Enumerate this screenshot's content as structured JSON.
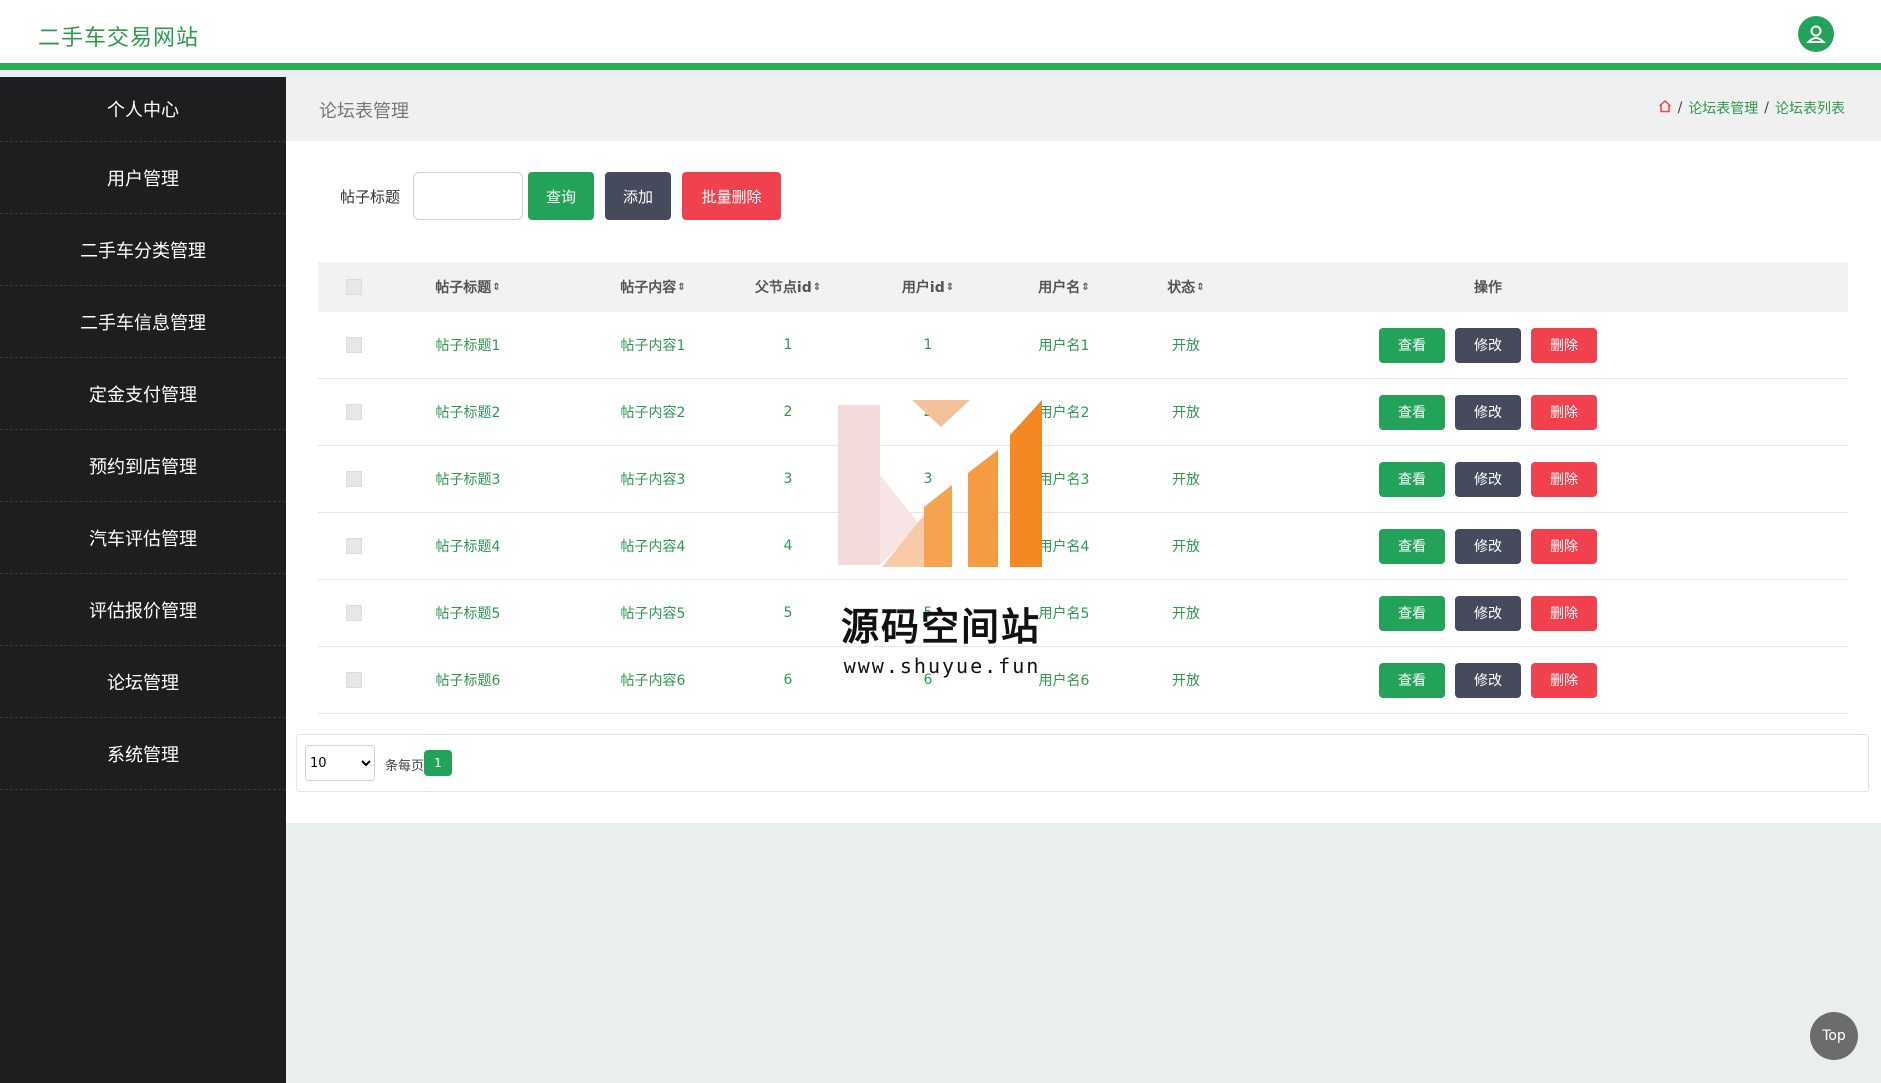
{
  "header": {
    "site_title": "二手车交易网站",
    "user_icon": "user-icon"
  },
  "sidebar": {
    "items": [
      {
        "label": "个人中心"
      },
      {
        "label": "用户管理"
      },
      {
        "label": "二手车分类管理"
      },
      {
        "label": "二手车信息管理"
      },
      {
        "label": "定金支付管理"
      },
      {
        "label": "预约到店管理"
      },
      {
        "label": "汽车评估管理"
      },
      {
        "label": "评估报价管理"
      },
      {
        "label": "论坛管理"
      },
      {
        "label": "系统管理"
      }
    ]
  },
  "page": {
    "title": "论坛表管理",
    "breadcrumb": [
      "论坛表管理",
      "论坛表列表"
    ]
  },
  "search": {
    "label": "帖子标题",
    "value": "",
    "query_label": "查询",
    "add_label": "添加",
    "batch_delete_label": "批量删除"
  },
  "table": {
    "headers": {
      "title": "帖子标题",
      "content": "帖子内容",
      "parent_id": "父节点id",
      "user_id": "用户id",
      "username": "用户名",
      "status": "状态",
      "ops": "操作"
    },
    "rows": [
      {
        "title": "帖子标题1",
        "content": "帖子内容1",
        "parent_id": "1",
        "user_id": "1",
        "username": "用户名1",
        "status": "开放"
      },
      {
        "title": "帖子标题2",
        "content": "帖子内容2",
        "parent_id": "2",
        "user_id": "2",
        "username": "用户名2",
        "status": "开放"
      },
      {
        "title": "帖子标题3",
        "content": "帖子内容3",
        "parent_id": "3",
        "user_id": "3",
        "username": "用户名3",
        "status": "开放"
      },
      {
        "title": "帖子标题4",
        "content": "帖子内容4",
        "parent_id": "4",
        "user_id": "4",
        "username": "用户名4",
        "status": "开放"
      },
      {
        "title": "帖子标题5",
        "content": "帖子内容5",
        "parent_id": "5",
        "user_id": "5",
        "username": "用户名5",
        "status": "开放"
      },
      {
        "title": "帖子标题6",
        "content": "帖子内容6",
        "parent_id": "6",
        "user_id": "6",
        "username": "用户名6",
        "status": "开放"
      }
    ],
    "op_view": "查看",
    "op_edit": "修改",
    "op_delete": "删除"
  },
  "pagination": {
    "page_size": "10",
    "per_page_label": "条每页",
    "current_page": "1"
  },
  "watermark": {
    "text": "源码空间站",
    "url": "www.shuyue.fun"
  },
  "top_button": {
    "label": "Top"
  },
  "colors": {
    "accent": "#23a25a",
    "dark_button": "#454b5d",
    "danger": "#f2414e",
    "sidebar_bg": "#1e1e20"
  }
}
